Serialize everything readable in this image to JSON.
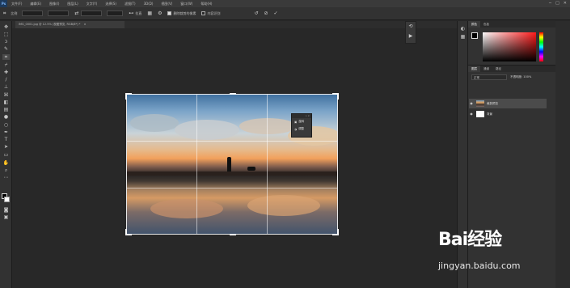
{
  "menubar": {
    "logo": "Ps",
    "items": [
      "文件(F)",
      "编辑(E)",
      "图像(I)",
      "图层(L)",
      "文字(Y)",
      "选择(S)",
      "滤镜(T)",
      "3D(D)",
      "视图(V)",
      "窗口(W)",
      "帮助(H)"
    ],
    "controls": [
      "─",
      "□",
      "✕"
    ]
  },
  "options": {
    "ratio_label": "比例",
    "straighten_label": "拉直",
    "delete_cropped_label": "删除裁剪的像素",
    "content_aware_label": "内容识别",
    "reset_icon": "↺",
    "cancel_icon": "⊘",
    "commit_icon": "✓"
  },
  "document": {
    "tab_label": "IMG_0001.jpg @ 12.5% (视图预览, RGB/8*) *",
    "close_icon": "×"
  },
  "context_panel": {
    "items": [
      "旋转",
      "调整"
    ]
  },
  "right_panel": {
    "color_tabs": [
      "颜色",
      "色板"
    ],
    "layer_tabs": [
      "图层",
      "通道",
      "路径"
    ],
    "layer_kind": "正常",
    "opacity": "不透明度: 100%",
    "layers": [
      {
        "name": "裁剪预览",
        "visible": true
      },
      {
        "name": "背景",
        "visible": true
      }
    ]
  },
  "colors": {
    "foreground": "#000000",
    "background": "#ffffff"
  },
  "watermark": {
    "logo": "Bai经验",
    "sub": "jingyan.baidu.com"
  }
}
